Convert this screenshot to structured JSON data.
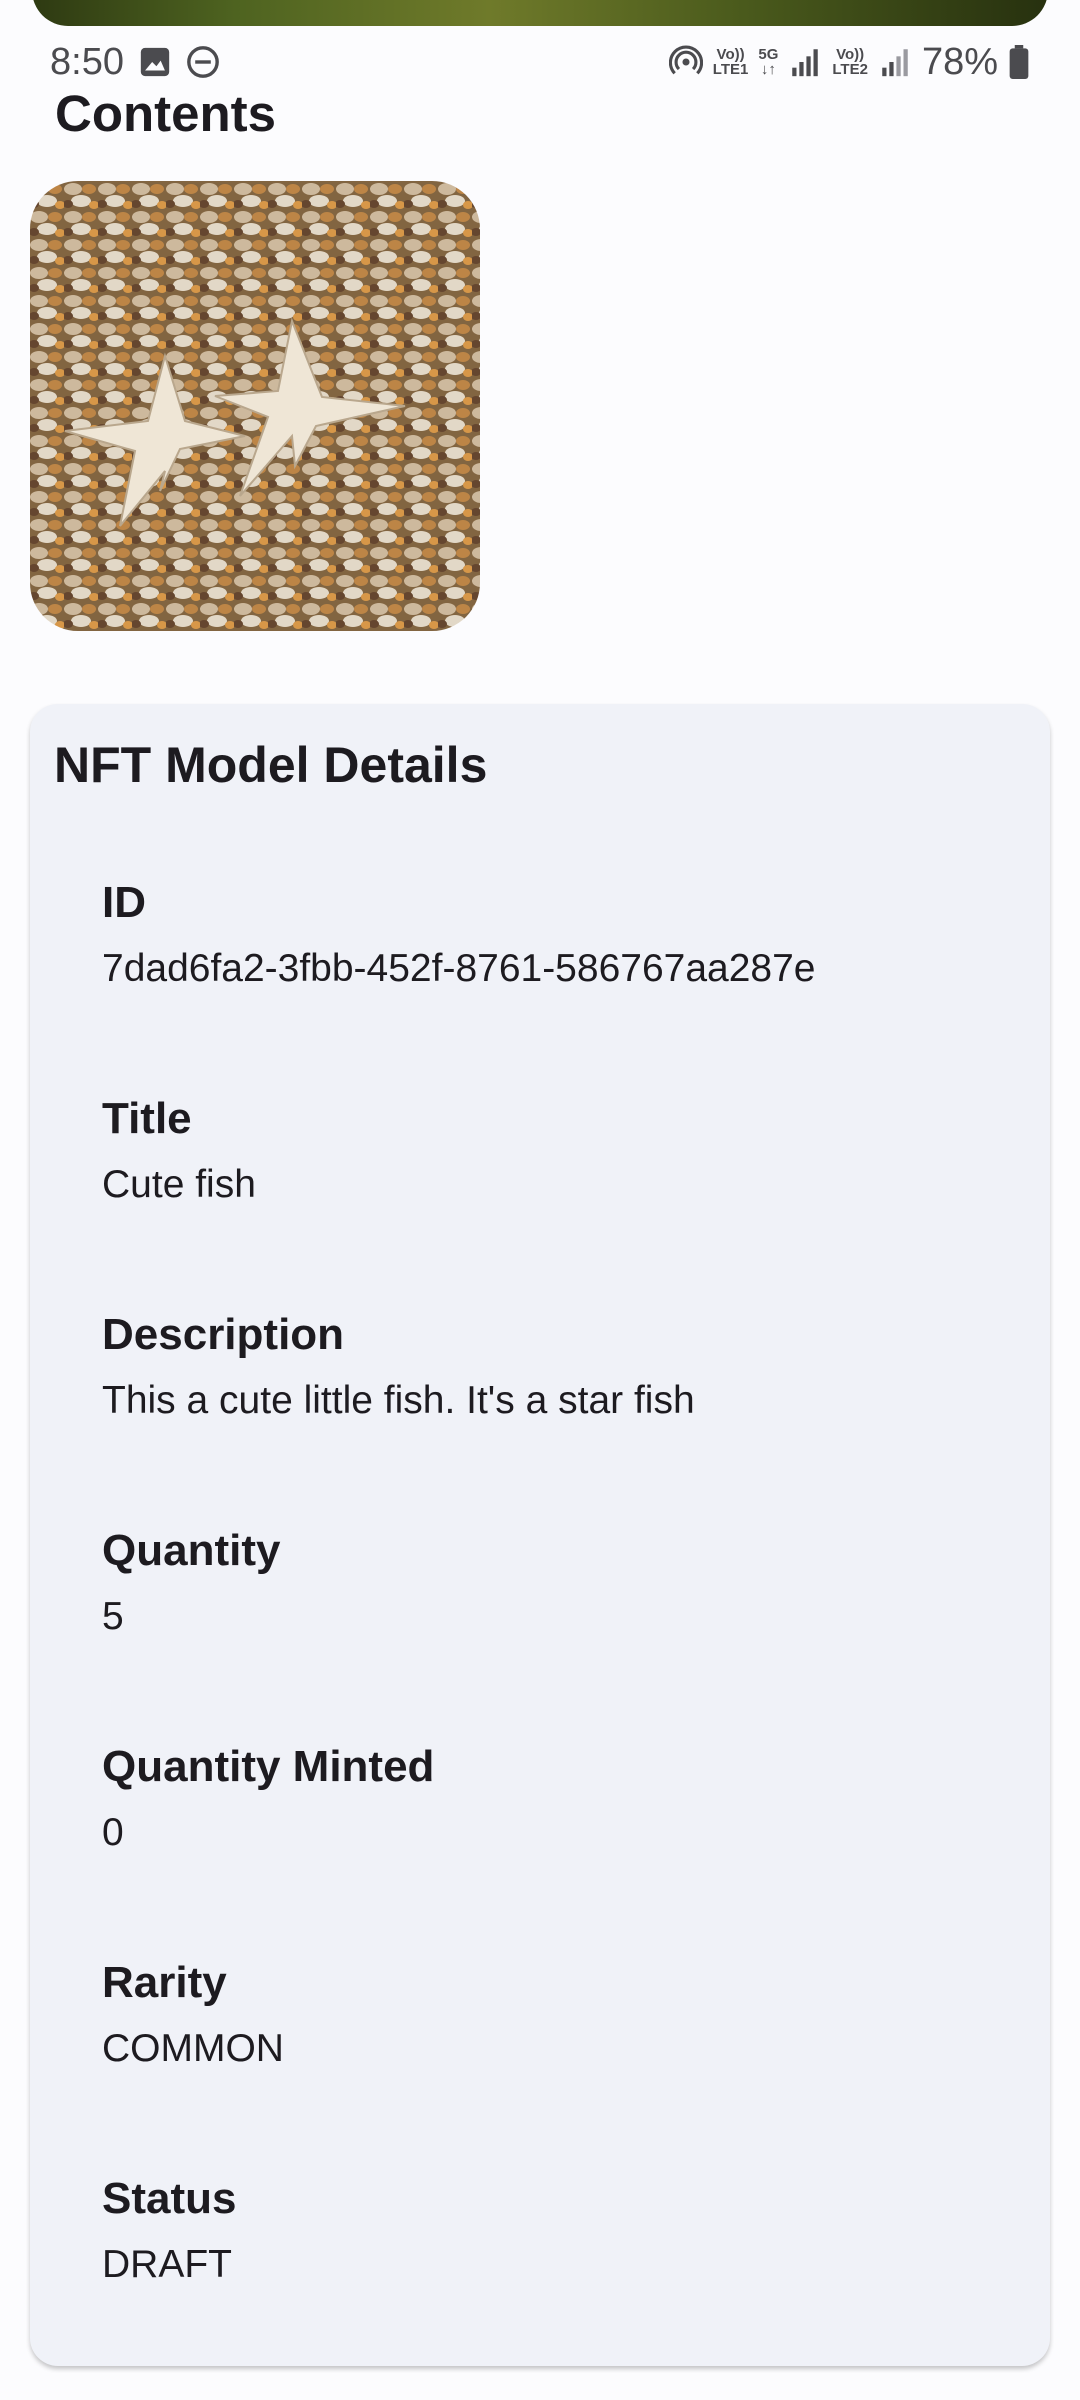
{
  "status_bar": {
    "time": "8:50",
    "network_1_top": "Vo))",
    "network_1_bottom": "LTE1",
    "network_5g": "5G",
    "network_2_top": "Vo))",
    "network_2_bottom": "LTE2",
    "battery": "78%"
  },
  "header": {
    "title": "Contents"
  },
  "media": {
    "thumbnail_icon": "starfish-image"
  },
  "details": {
    "title": "NFT Model Details",
    "fields": [
      {
        "label": "ID",
        "value": "7dad6fa2-3fbb-452f-8761-586767aa287e"
      },
      {
        "label": "Title",
        "value": "Cute fish"
      },
      {
        "label": "Description",
        "value": "This a cute little fish. It's a star fish"
      },
      {
        "label": "Quantity",
        "value": "5"
      },
      {
        "label": "Quantity Minted",
        "value": "0"
      },
      {
        "label": "Rarity",
        "value": "COMMON"
      },
      {
        "label": "Status",
        "value": "DRAFT"
      }
    ]
  },
  "colors": {
    "background": "#fcfcfe",
    "card": "#f0f2f8",
    "text": "#1d1b20"
  }
}
